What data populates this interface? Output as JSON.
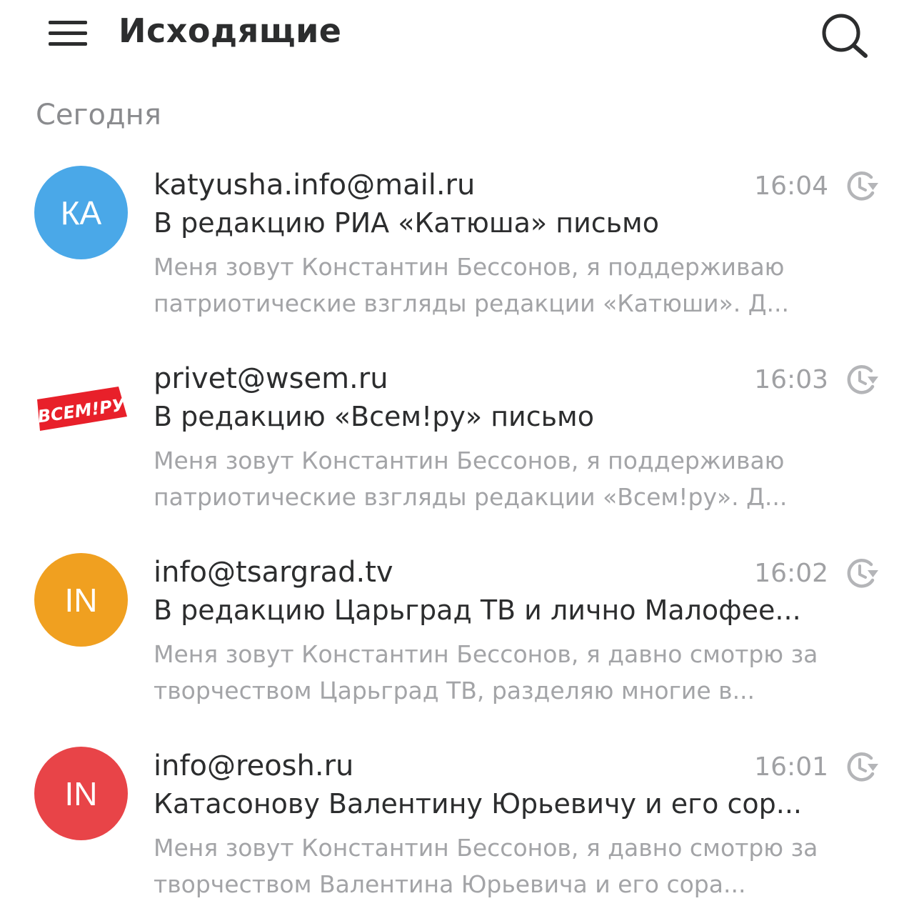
{
  "header": {
    "title": "Исходящие"
  },
  "section_label": "Сегодня",
  "messages": [
    {
      "avatar_text": "КА",
      "avatar_color": "#4aa8e8",
      "sender": "katyusha.info@mail.ru",
      "time": "16:04",
      "subject": "В редакцию РИА «Катюша» письмо",
      "snippet": "Меня зовут Константин Бессонов, я поддерживаю патриотические взгляды редакции «Катюши». Д..."
    },
    {
      "avatar_text": "ВСЕМ!РУ",
      "avatar_color": "#e8202a",
      "sender": "privet@wsem.ru",
      "time": "16:03",
      "subject": "В редакцию «Всем!ру» письмо",
      "snippet": "Меня зовут Константин Бессонов, я поддерживаю патриотические взгляды редакции «Всем!ру». Д..."
    },
    {
      "avatar_text": "IN",
      "avatar_color": "#f0a020",
      "sender": "info@tsargrad.tv",
      "time": "16:02",
      "subject": "В редакцию Царьград ТВ и лично Малофее...",
      "snippet": "Меня зовут Константин Бессонов, я давно смотрю за творчеством Царьград ТВ, разделяю многие в..."
    },
    {
      "avatar_text": "IN",
      "avatar_color": "#e84448",
      "sender": "info@reosh.ru",
      "time": "16:01",
      "subject": "Катасонову Валентину Юрьевичу и его сор...",
      "snippet": "Меня зовут Константин Бессонов, я давно смотрю за творчеством Валентина Юрьевича и его сора..."
    }
  ],
  "icons": {
    "menu": "hamburger-menu-icon",
    "search": "search-icon",
    "status": "clock-send-scheduled-icon"
  }
}
